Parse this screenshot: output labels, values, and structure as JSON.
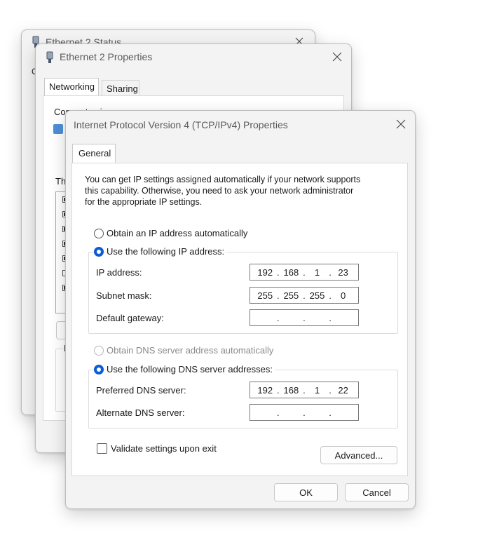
{
  "status_window": {
    "title": "Ethernet 2 Status",
    "tab_fragment": "G"
  },
  "properties_window": {
    "title": "Ethernet 2 Properties",
    "tabs": [
      "Networking",
      "Sharing"
    ],
    "connect_using_label": "Connect using:",
    "this_connection_fragment": "Thi",
    "description_fragment": "D"
  },
  "ipv4_dialog": {
    "title": "Internet Protocol Version 4 (TCP/IPv4) Properties",
    "tab": "General",
    "description": [
      "You can get IP settings assigned automatically if your network supports",
      "this capability. Otherwise, you need to ask your network administrator",
      "for the appropriate IP settings."
    ],
    "ip_mode": {
      "auto_label": "Obtain an IP address automatically",
      "manual_label": "Use the following IP address:",
      "selected": "manual"
    },
    "ip_fields": {
      "ip_address_label": "IP address:",
      "ip_address": [
        "192",
        "168",
        "1",
        "23"
      ],
      "subnet_mask_label": "Subnet mask:",
      "subnet_mask": [
        "255",
        "255",
        "255",
        "0"
      ],
      "default_gateway_label": "Default gateway:",
      "default_gateway": [
        "",
        "",
        "",
        ""
      ]
    },
    "dns_mode": {
      "auto_label": "Obtain DNS server address automatically",
      "manual_label": "Use the following DNS server addresses:",
      "selected": "manual",
      "auto_disabled": true
    },
    "dns_fields": {
      "preferred_label": "Preferred DNS server:",
      "preferred": [
        "192",
        "168",
        "1",
        "22"
      ],
      "alternate_label": "Alternate DNS server:",
      "alternate": [
        "",
        "",
        "",
        ""
      ]
    },
    "validate_label": "Validate settings upon exit",
    "validate_checked": false,
    "advanced_label": "Advanced...",
    "ok_label": "OK",
    "cancel_label": "Cancel"
  },
  "colors": {
    "accent": "#0b5cd5",
    "window_bg": "#f3f3f3",
    "panel_bg": "#ffffff"
  }
}
